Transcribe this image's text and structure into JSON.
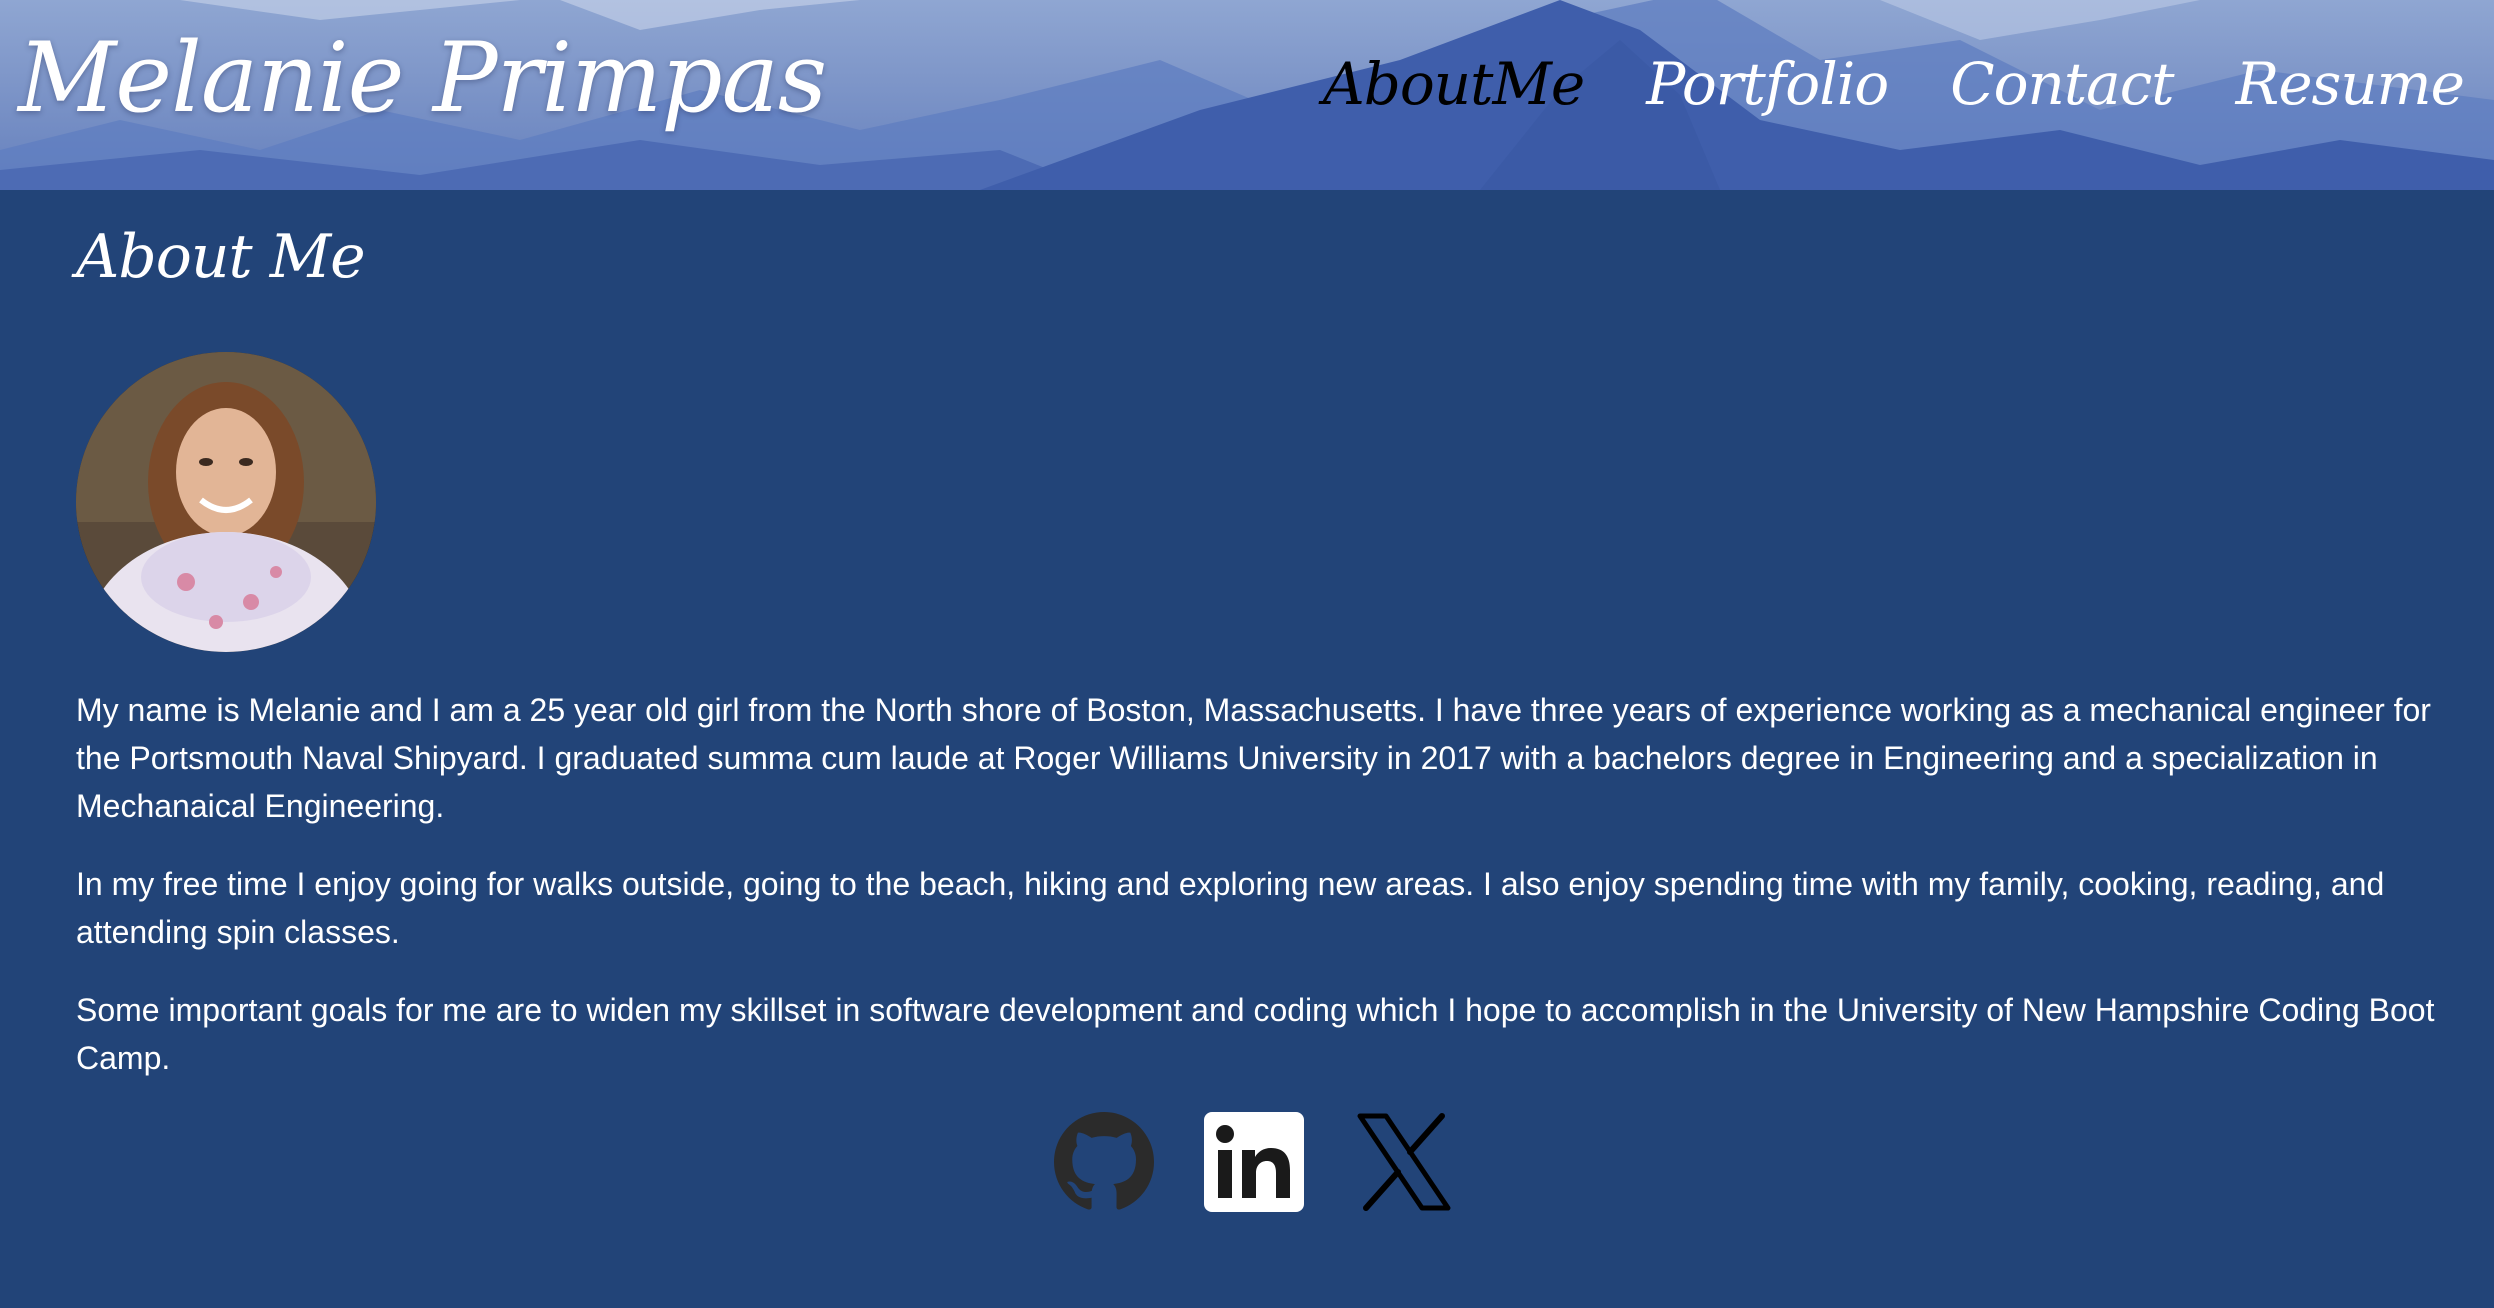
{
  "header": {
    "site_title": "Melanie Primpas",
    "nav": [
      {
        "label": "AboutMe",
        "active": true
      },
      {
        "label": "Portfolio",
        "active": false
      },
      {
        "label": "Contact",
        "active": false
      },
      {
        "label": "Resume",
        "active": false
      }
    ]
  },
  "about": {
    "title": "About Me",
    "paragraphs": [
      "My name is Melanie and I am a 25 year old girl from the North shore of Boston, Massachusetts. I have three years of experience working as a mechanical engineer for the Portsmouth Naval Shipyard. I graduated summa cum laude at Roger Williams University in 2017 with a bachelors degree in Engineering and a specialization in Mechanaical Engineering.",
      "In my free time I enjoy going for walks outside, going to the beach, hiking and exploring new areas. I also enjoy spending time with my family, cooking, reading, and attending spin classes.",
      "Some important goals for me are to widen my skillset in software development and coding which I hope to accomplish in the University of New Hampshire Coding Boot Camp."
    ]
  },
  "social_icons": [
    "github-icon",
    "linkedin-icon",
    "x-icon"
  ],
  "colors": {
    "page_background": "#224478",
    "text": "#ffffff",
    "active_nav": "#000000",
    "icon_dark": "#2b2b2b"
  }
}
